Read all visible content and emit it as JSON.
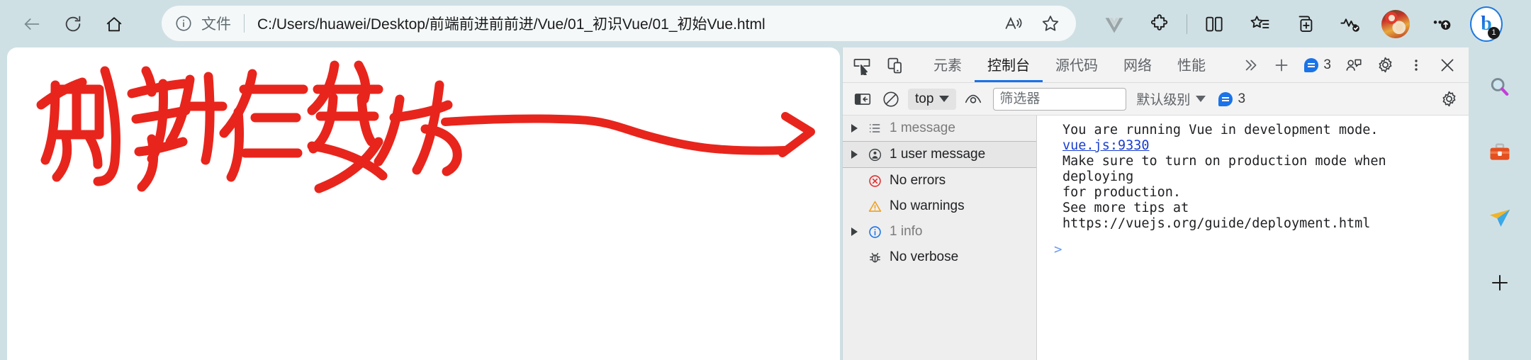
{
  "browser": {
    "nav": {
      "back_label": "Back",
      "refresh_label": "Refresh",
      "home_label": "Home"
    },
    "omnibox": {
      "scheme_label": "文件",
      "url": "C:/Users/huawei/Desktop/前端前进前前进/Vue/01_初识Vue/01_初始Vue.html",
      "read_aloud_label": "朗读此页面",
      "favorite_label": "添加到收藏夹"
    },
    "toolbar_icons": [
      {
        "name": "vue-devtools-icon",
        "label": "Vue.js devtools"
      },
      {
        "name": "extensions-icon",
        "label": "扩展"
      },
      {
        "name": "split-screen-icon",
        "label": "拆分屏幕"
      },
      {
        "name": "favorites-icon",
        "label": "收藏夹"
      },
      {
        "name": "collections-icon",
        "label": "集锦"
      },
      {
        "name": "browser-essentials-icon",
        "label": "浏览器基本功能"
      },
      {
        "name": "profile-avatar",
        "label": "个人资料"
      },
      {
        "name": "settings-more-icon",
        "label": "设置及其他"
      },
      {
        "name": "copilot-icon",
        "label": "Copilot"
      }
    ],
    "copilot_badge": "1"
  },
  "annotation": {
    "text": "刷新后变为",
    "color": "#e8251c",
    "arrow_target": "1 user message"
  },
  "devtools": {
    "header": {
      "inspect_label": "检查",
      "device_toggle_label": "切换设备仿真",
      "tabs": [
        {
          "label": "元素",
          "active": false
        },
        {
          "label": "控制台",
          "active": true
        },
        {
          "label": "源代码",
          "active": false
        },
        {
          "label": "网络",
          "active": false
        },
        {
          "label": "性能",
          "active": false
        }
      ],
      "more_tabs_label": "更多工具",
      "add_tab_label": "更多工具",
      "issues_count": "3",
      "inspect_more_label": "自定义",
      "settings_label": "设置",
      "more_options_label": "自定义及控制",
      "close_label": "关闭"
    },
    "console_toolbar": {
      "sidebar_toggle_label": "显示控制台边栏",
      "clear_label": "清空控制台",
      "context_value": "top",
      "eye_label": "创建实时表达式",
      "filter_placeholder": "筛选器",
      "filter_value": "",
      "levels_value": "默认级别",
      "issues_count": "3",
      "settings_label": "控制台设置"
    },
    "sidebar_items": [
      {
        "label": "1 message",
        "icon": "list-icon",
        "expandable": true,
        "muted": true,
        "selected": false
      },
      {
        "label": "1 user message",
        "icon": "user-message-icon",
        "expandable": true,
        "muted": false,
        "selected": true
      },
      {
        "label": "No errors",
        "icon": "error-icon",
        "expandable": false,
        "muted": false,
        "selected": false
      },
      {
        "label": "No warnings",
        "icon": "warning-icon",
        "expandable": false,
        "muted": false,
        "selected": false
      },
      {
        "label": "1 info",
        "icon": "info-icon",
        "expandable": true,
        "muted": true,
        "selected": false
      },
      {
        "label": "No verbose",
        "icon": "verbose-bug-icon",
        "expandable": false,
        "muted": false,
        "selected": false
      }
    ],
    "console_message": {
      "line1": "You are running Vue in development mode.",
      "source": "vue.js:9330",
      "line2": "Make sure to turn on production mode when deploying",
      "line3": "for production.",
      "line4_prefix": "See more tips at ",
      "line4_link": "https://vuejs.org/guide/deployment.html"
    },
    "prompt_symbol": ">"
  },
  "edge_sidebar": [
    {
      "name": "search-icon",
      "label": "搜索"
    },
    {
      "name": "tools-icon",
      "label": "工具"
    },
    {
      "name": "send-icon",
      "label": "发送"
    },
    {
      "name": "add-icon",
      "label": "添加"
    }
  ],
  "colors": {
    "chrome_bg": "#cfe0e5",
    "accent_blue": "#1a73e8",
    "annotation_red": "#e8251c",
    "error_red": "#e03131",
    "warning_orange": "#f0a020",
    "info_blue": "#1a73e8"
  }
}
